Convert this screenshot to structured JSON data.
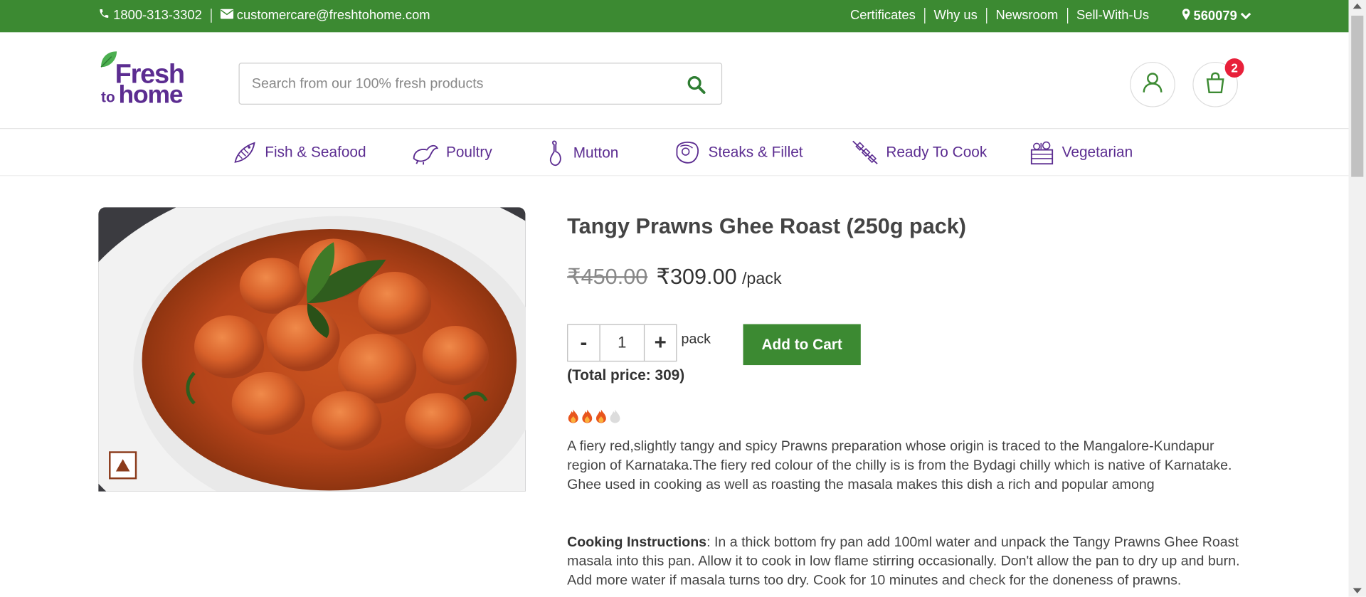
{
  "topbar": {
    "phone": "1800-313-3302",
    "email": "customercare@freshtohome.com",
    "links": [
      "Certificates",
      "Why us",
      "Newsroom",
      "Sell-With-Us"
    ],
    "pincode": "560079"
  },
  "header": {
    "logo_top": "Fresh",
    "logo_to": "to",
    "logo_home": "home",
    "search_placeholder": "Search from our 100% fresh products",
    "cart_count": "2"
  },
  "nav": {
    "items": [
      {
        "label": "Fish & Seafood",
        "icon": "fish-icon"
      },
      {
        "label": "Poultry",
        "icon": "chicken-icon"
      },
      {
        "label": "Mutton",
        "icon": "mutton-leg-icon"
      },
      {
        "label": "Steaks & Fillet",
        "icon": "steak-icon"
      },
      {
        "label": "Ready To Cook",
        "icon": "skewer-icon"
      },
      {
        "label": "Vegetarian",
        "icon": "vegetable-basket-icon"
      }
    ]
  },
  "product": {
    "title": "Tangy Prawns Ghee Roast (250g pack)",
    "old_price": "₹450.00",
    "price": "₹309.00",
    "unit": "/pack",
    "quantity": "1",
    "qty_minus": "-",
    "qty_plus": "+",
    "pack_label": "pack",
    "add_to_cart": "Add to Cart",
    "total_price": "(Total price: 309)",
    "spice_level": 3,
    "spice_max": 4,
    "description": "A fiery red,slightly tangy and spicy Prawns preparation whose origin is traced to the Mangalore-Kundapur region of Karnataka.The fiery red colour of the chilly is is from the Bydagi chilly which is native of Karnatake. Ghee used in cooking as well as roasting the masala makes this dish a rich and popular among",
    "cooking_label": "Cooking Instructions",
    "cooking_text": ": In a thick bottom fry pan add 100ml water and unpack the Tangy Prawns Ghee Roast masala into this pan. Allow it to cook in low flame stirring occasionally. Don't allow the pan to dry up and burn. Add more water if masala turns too dry. Cook for 10 minutes and check for the doneness of prawns."
  },
  "colors": {
    "brand_green": "#3c8a32",
    "brand_purple": "#5c2d91",
    "badge_red": "#e8203a"
  }
}
